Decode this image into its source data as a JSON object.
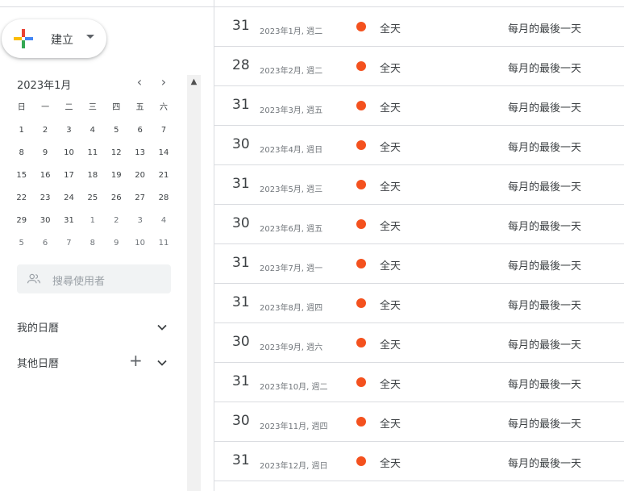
{
  "create": {
    "label": "建立"
  },
  "mini_calendar": {
    "month_label": "2023年1月",
    "weekdays": [
      "日",
      "一",
      "二",
      "三",
      "四",
      "五",
      "六"
    ],
    "weeks": [
      [
        {
          "d": "1"
        },
        {
          "d": "2"
        },
        {
          "d": "3"
        },
        {
          "d": "4"
        },
        {
          "d": "5"
        },
        {
          "d": "6"
        },
        {
          "d": "7"
        }
      ],
      [
        {
          "d": "8"
        },
        {
          "d": "9"
        },
        {
          "d": "10"
        },
        {
          "d": "11"
        },
        {
          "d": "12"
        },
        {
          "d": "13"
        },
        {
          "d": "14"
        }
      ],
      [
        {
          "d": "15"
        },
        {
          "d": "16"
        },
        {
          "d": "17"
        },
        {
          "d": "18"
        },
        {
          "d": "19"
        },
        {
          "d": "20"
        },
        {
          "d": "21"
        }
      ],
      [
        {
          "d": "22"
        },
        {
          "d": "23"
        },
        {
          "d": "24"
        },
        {
          "d": "25"
        },
        {
          "d": "26"
        },
        {
          "d": "27"
        },
        {
          "d": "28"
        }
      ],
      [
        {
          "d": "29"
        },
        {
          "d": "30"
        },
        {
          "d": "31"
        },
        {
          "d": "1",
          "dim": true
        },
        {
          "d": "2",
          "dim": true
        },
        {
          "d": "3",
          "dim": true
        },
        {
          "d": "4",
          "dim": true
        }
      ],
      [
        {
          "d": "5",
          "dim": true
        },
        {
          "d": "6",
          "dim": true
        },
        {
          "d": "7",
          "dim": true
        },
        {
          "d": "8",
          "dim": true
        },
        {
          "d": "9",
          "dim": true
        },
        {
          "d": "10",
          "dim": true
        },
        {
          "d": "11",
          "dim": true
        }
      ]
    ]
  },
  "people_search": {
    "placeholder": "搜尋使用者"
  },
  "my_calendars": {
    "label": "我的日曆"
  },
  "other_calendars": {
    "label": "其他日曆"
  },
  "events": [
    {
      "day": "31",
      "date": "2023年1月, 週二",
      "allday": "全天",
      "title": "每月的最後一天"
    },
    {
      "day": "28",
      "date": "2023年2月, 週二",
      "allday": "全天",
      "title": "每月的最後一天"
    },
    {
      "day": "31",
      "date": "2023年3月, 週五",
      "allday": "全天",
      "title": "每月的最後一天"
    },
    {
      "day": "30",
      "date": "2023年4月, 週日",
      "allday": "全天",
      "title": "每月的最後一天"
    },
    {
      "day": "31",
      "date": "2023年5月, 週三",
      "allday": "全天",
      "title": "每月的最後一天"
    },
    {
      "day": "30",
      "date": "2023年6月, 週五",
      "allday": "全天",
      "title": "每月的最後一天"
    },
    {
      "day": "31",
      "date": "2023年7月, 週一",
      "allday": "全天",
      "title": "每月的最後一天"
    },
    {
      "day": "31",
      "date": "2023年8月, 週四",
      "allday": "全天",
      "title": "每月的最後一天"
    },
    {
      "day": "30",
      "date": "2023年9月, 週六",
      "allday": "全天",
      "title": "每月的最後一天"
    },
    {
      "day": "31",
      "date": "2023年10月, 週二",
      "allday": "全天",
      "title": "每月的最後一天"
    },
    {
      "day": "30",
      "date": "2023年11月, 週四",
      "allday": "全天",
      "title": "每月的最後一天"
    },
    {
      "day": "31",
      "date": "2023年12月, 週日",
      "allday": "全天",
      "title": "每月的最後一天"
    }
  ],
  "colors": {
    "event_dot": "#f4511e",
    "accent": "#1a73e8"
  }
}
